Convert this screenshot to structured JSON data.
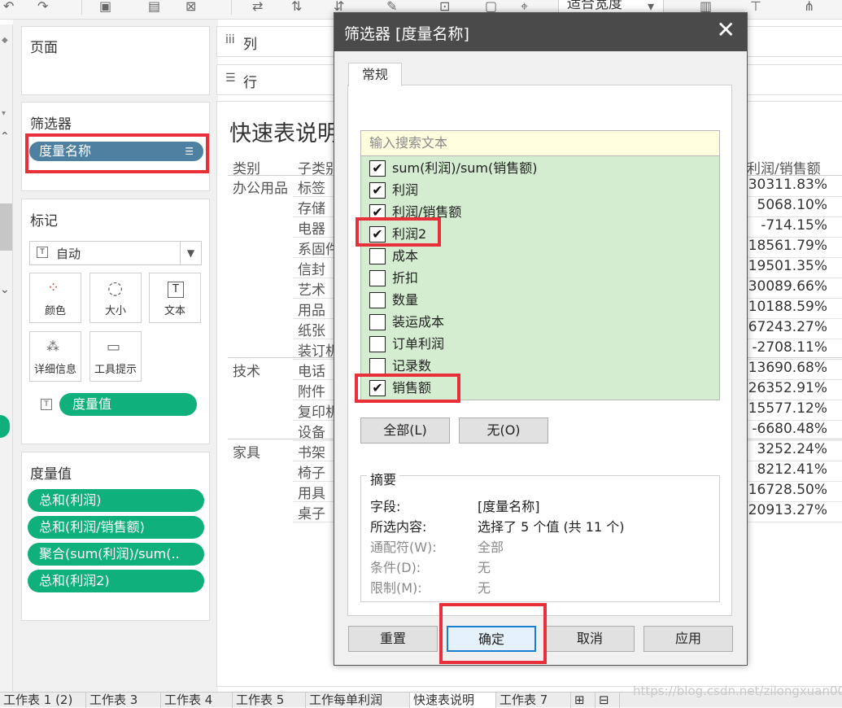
{
  "toolbar": {
    "fit_label": "适合宽度"
  },
  "panels": {
    "pages_title": "页面",
    "filters_title": "筛选器",
    "filter_pill": "度量名称",
    "marks_title": "标记",
    "marks_type": "自动",
    "mark_buttons": [
      "颜色",
      "大小",
      "文本",
      "详细信息",
      "工具提示"
    ],
    "marks_pill": "度量值",
    "measure_values_title": "度量值",
    "measure_pills": [
      "总和(利润)",
      "总和(利润/销售额)",
      "聚合(sum(利润)/sum(..",
      "总和(利润2)"
    ]
  },
  "shelves": {
    "columns": "列",
    "rows": "行"
  },
  "sheet": {
    "title": "快速表说明",
    "col_category": "类别",
    "col_subcategory": "子类别",
    "col_measure": "利润/销售额",
    "categories": [
      "办公用品",
      "技术",
      "家具"
    ],
    "subcategories": [
      "标签",
      "存储",
      "电器",
      "系固件",
      "信封",
      "艺术",
      "用品",
      "纸张",
      "装订机",
      "电话",
      "附件",
      "复印机",
      "设备",
      "书架",
      "椅子",
      "用具",
      "桌子"
    ],
    "values": [
      "30311.83%",
      "5068.10%",
      "-714.15%",
      "18561.79%",
      "19501.35%",
      "30089.66%",
      "10188.59%",
      "67243.27%",
      "-2708.11%",
      "13690.68%",
      "26352.91%",
      "15577.12%",
      "-6680.48%",
      "3252.24%",
      "8212.41%",
      "16728.50%",
      "20913.27%"
    ]
  },
  "tabs": [
    "工作表 1 (2)",
    "工作表 3",
    "工作表 4",
    "工作表 5",
    "工作每单利润",
    "快速表说明",
    "工作表 7"
  ],
  "watermark": "https://blog.csdn.net/zilongxuan008",
  "dialog": {
    "title": "筛选器 [度量名称]",
    "tab": "常规",
    "search_placeholder": "输入搜索文本",
    "items": [
      {
        "label": "sum(利润)/sum(销售额)",
        "checked": true
      },
      {
        "label": "利润",
        "checked": true
      },
      {
        "label": "利润/销售额",
        "checked": true
      },
      {
        "label": "利润2",
        "checked": true
      },
      {
        "label": "成本",
        "checked": false
      },
      {
        "label": "折扣",
        "checked": false
      },
      {
        "label": "数量",
        "checked": false
      },
      {
        "label": "装运成本",
        "checked": false
      },
      {
        "label": "订单利润",
        "checked": false
      },
      {
        "label": "记录数",
        "checked": false
      },
      {
        "label": "销售额",
        "checked": true
      }
    ],
    "all_button": "全部(L)",
    "none_button": "无(O)",
    "summary_title": "摘要",
    "summary": {
      "field_label": "字段:",
      "field_value": "[度量名称]",
      "selected_label": "所选内容:",
      "selected_value": "选择了 5 个值 (共 11 个)",
      "wildcard_label": "通配符(W):",
      "wildcard_value": "全部",
      "condition_label": "条件(D):",
      "condition_value": "无",
      "limit_label": "限制(M):",
      "limit_value": "无"
    },
    "buttons": {
      "reset": "重置",
      "ok": "确定",
      "cancel": "取消",
      "apply": "应用"
    }
  },
  "colors": {
    "highlight": "#e8303a",
    "pill_blue": "#4e81a1",
    "pill_green": "#0fb07b",
    "list_bg": "#d4edd0"
  }
}
